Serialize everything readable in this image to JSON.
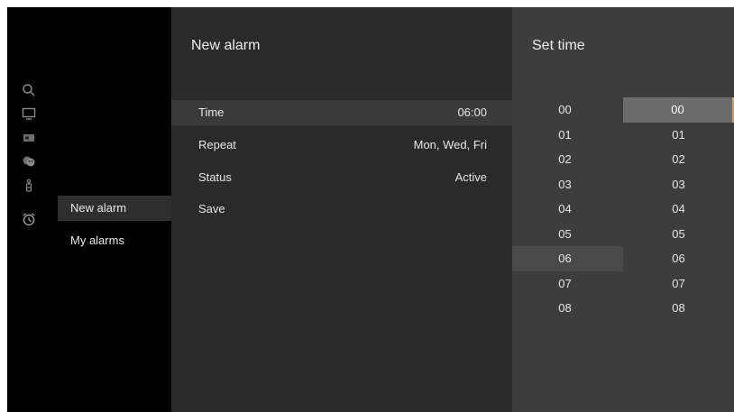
{
  "rail": {
    "icons": [
      "search-icon",
      "tv-icon",
      "input-icon",
      "theater-mask-icon",
      "accessibility-icon",
      "alarm-clock-icon"
    ]
  },
  "submenu": {
    "items": [
      {
        "label": "New alarm",
        "selected": true
      },
      {
        "label": "My alarms",
        "selected": false
      }
    ]
  },
  "new_alarm": {
    "title": "New alarm",
    "rows": [
      {
        "label": "Time",
        "value": "06:00",
        "focused": true
      },
      {
        "label": "Repeat",
        "value": "Mon, Wed, Fri",
        "focused": false
      },
      {
        "label": "Status",
        "value": "Active",
        "focused": false
      },
      {
        "label": "Save",
        "value": "",
        "focused": false
      }
    ]
  },
  "set_time": {
    "title": "Set time",
    "hours": [
      "00",
      "01",
      "02",
      "03",
      "04",
      "05",
      "06",
      "07",
      "08"
    ],
    "minutes": [
      "00",
      "01",
      "02",
      "03",
      "04",
      "05",
      "06",
      "07",
      "08"
    ],
    "selected_hour": "06",
    "selected_minute": "00"
  },
  "colors": {
    "background": "#000000",
    "panel_middle": "#2a2a2a",
    "panel_right": "#3d3d3d",
    "selection": "#6b6b6b",
    "accent_edge": "#c8a078"
  }
}
